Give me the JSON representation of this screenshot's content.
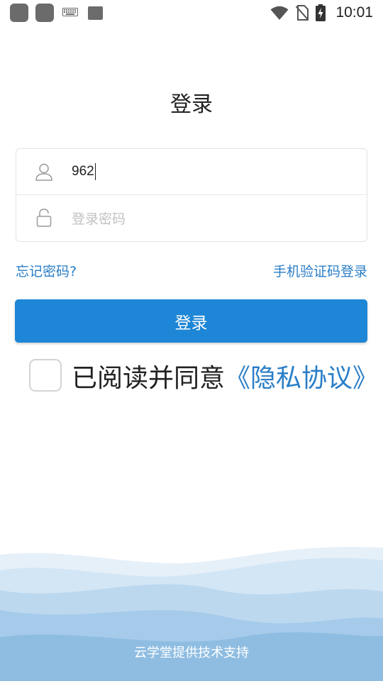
{
  "status_bar": {
    "time": "10:01",
    "icons": [
      "app-icon",
      "app-icon",
      "keyboard-icon",
      "notification-icon",
      "wifi-icon",
      "no-sim-icon",
      "battery-charging-icon"
    ]
  },
  "page": {
    "title": "登录"
  },
  "form": {
    "username_value": "962",
    "password_placeholder": "登录密码"
  },
  "links": {
    "forgot_password": "忘记密码?",
    "sms_login": "手机验证码登录"
  },
  "login_button": "登录",
  "agreement": {
    "text": "已阅读并同意",
    "link": "《隐私协议》",
    "checked": false
  },
  "footer": {
    "text": "云学堂提供技术支持"
  },
  "colors": {
    "accent": "#1e86d6",
    "link": "#2a7ec7",
    "wave_dark": "#8fbde2",
    "wave_light": "#e6f0f9"
  }
}
